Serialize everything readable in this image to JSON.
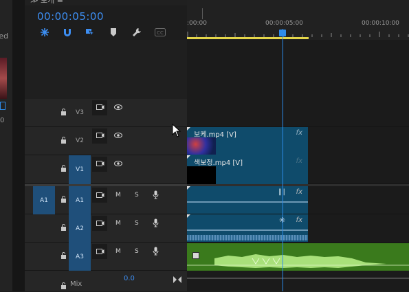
{
  "left_panel": {
    "label": "cted",
    "value": "0"
  },
  "panel_tab": {
    "title": "≫ 보케 ≡"
  },
  "timecode": "00:00:05:00",
  "tools": [
    {
      "name": "insert-sequence-icon"
    },
    {
      "name": "snap-magnet-icon"
    },
    {
      "name": "linked-selection-icon"
    },
    {
      "name": "add-marker-icon"
    },
    {
      "name": "wrench-settings-icon"
    },
    {
      "name": "captions-icon",
      "label": "CC"
    }
  ],
  "ruler": {
    "labels": [
      ":00:00",
      "00:00:05:00",
      "00:00:10:00"
    ]
  },
  "tracks": [
    {
      "id": "V3",
      "name": "V3",
      "type": "video",
      "targeted": false
    },
    {
      "id": "V2",
      "name": "V2",
      "type": "video",
      "targeted": false
    },
    {
      "id": "V1",
      "name": "V1",
      "type": "video",
      "targeted": true
    },
    {
      "id": "A1",
      "name": "A1",
      "type": "audio",
      "targeted": true,
      "source": "A1",
      "m": "M",
      "s": "S"
    },
    {
      "id": "A2",
      "name": "A2",
      "type": "audio",
      "targeted": true,
      "m": "M",
      "s": "S"
    },
    {
      "id": "A3",
      "name": "A3",
      "type": "audio",
      "targeted": true,
      "m": "M",
      "s": "S"
    }
  ],
  "mix": {
    "label": "Mix",
    "value": "0.0"
  },
  "clips": {
    "v2": {
      "name": "보케.mp4 [V]",
      "fx": "fx"
    },
    "v1": {
      "name": "색보정.mp4 [V]",
      "fx": "fx"
    },
    "a1": {
      "fx": "fx"
    },
    "a2": {
      "fx": "fx"
    }
  },
  "colors": {
    "accent": "#2d8ceb",
    "clip_blue": "#0f4b6b",
    "clip_green": "#3a7a1c",
    "work_area": "#e4d64a"
  }
}
